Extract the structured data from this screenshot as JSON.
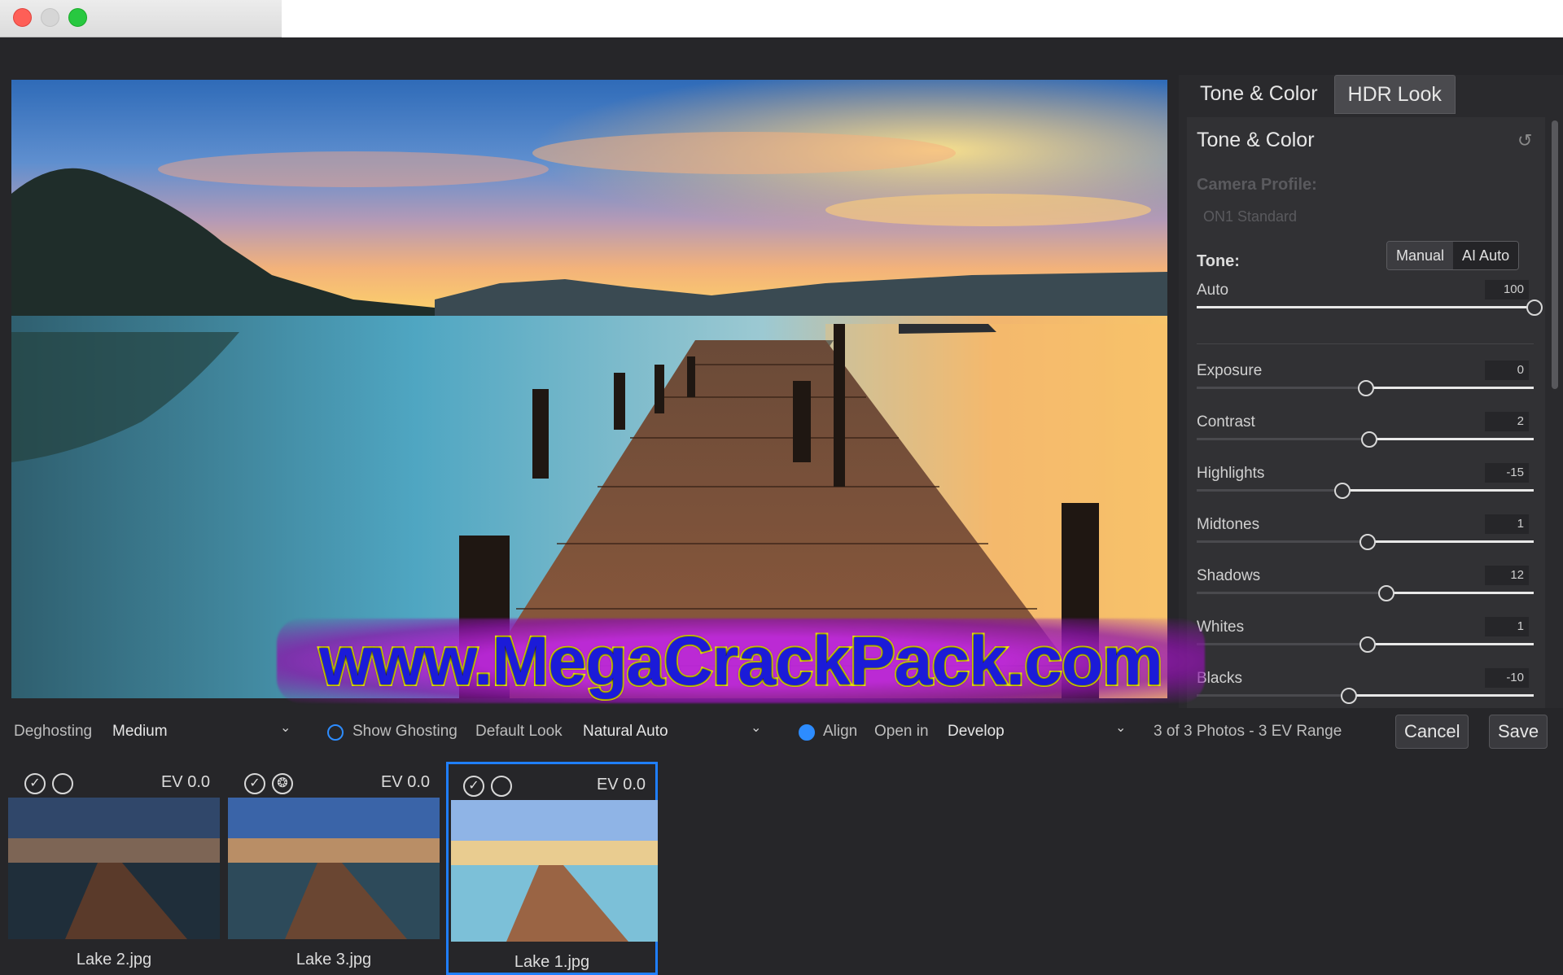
{
  "panel": {
    "tabs": [
      {
        "label": "Tone & Color"
      },
      {
        "label": "HDR Look"
      }
    ],
    "section_title": "Tone & Color",
    "camera_profile_label": "Camera Profile:",
    "camera_profile_value": "ON1 Standard",
    "tone_label": "Tone:",
    "tone_modes": [
      "Manual",
      "AI Auto"
    ],
    "sliders": [
      {
        "label": "Auto",
        "value": "100",
        "fraction": 1.0
      },
      {
        "label": "Exposure",
        "value": "0",
        "fraction": 0.5
      },
      {
        "label": "Contrast",
        "value": "2",
        "fraction": 0.51
      },
      {
        "label": "Highlights",
        "value": "-15",
        "fraction": 0.43
      },
      {
        "label": "Midtones",
        "value": "1",
        "fraction": 0.505
      },
      {
        "label": "Shadows",
        "value": "12",
        "fraction": 0.56
      },
      {
        "label": "Whites",
        "value": "1",
        "fraction": 0.505
      },
      {
        "label": "Blacks",
        "value": "-10",
        "fraction": 0.45
      }
    ]
  },
  "watermark": "www.MegaCrackPack.com",
  "bottombar": {
    "deghosting_label": "Deghosting",
    "deghosting_value": "Medium",
    "show_ghosting_label": "Show Ghosting",
    "default_look_label": "Default Look",
    "default_look_value": "Natural Auto",
    "align_label": "Align",
    "open_in_label": "Open in",
    "open_in_value": "Develop",
    "summary": "3 of 3 Photos - 3 EV Range",
    "cancel_label": "Cancel",
    "save_label": "Save"
  },
  "thumbnails": [
    {
      "name": "Lake 2.jpg",
      "ev": "EV 0.0"
    },
    {
      "name": "Lake 3.jpg",
      "ev": "EV 0.0"
    },
    {
      "name": "Lake 1.jpg",
      "ev": "EV 0.0"
    }
  ],
  "colors": {
    "accent": "#1f7fff",
    "close": "#fe5f57",
    "maximize": "#28c840"
  }
}
